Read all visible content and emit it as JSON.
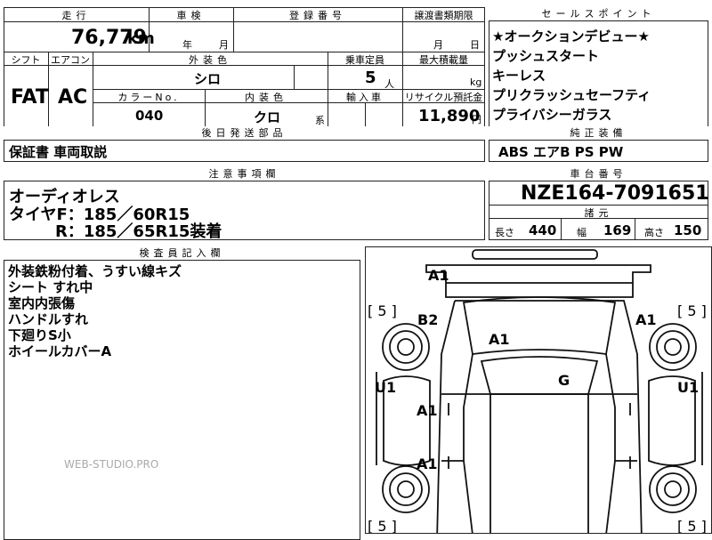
{
  "header": {
    "mileage_label": "走行",
    "shaken_label": "車検",
    "reg_label": "登録番号",
    "transfer_label": "譲渡書類期限",
    "sales_label": "セールスポイント"
  },
  "values": {
    "mileage": "76,779",
    "km_unit": "km",
    "shaken_year": "年",
    "shaken_month": "月",
    "transfer_month": "月",
    "transfer_day": "日"
  },
  "spec": {
    "shift_label": "シフト",
    "ac_label": "エアコン",
    "exterior_label": "外装色",
    "capacity_label": "乗車定員",
    "load_label": "最大積載量",
    "shift": "FAT",
    "ac": "AC",
    "exterior": "シロ",
    "capacity": "5",
    "capacity_unit": "人",
    "load_unit": "kg",
    "color_no_label": "カラーNo.",
    "interior_label": "内装色",
    "import_label": "輸入車",
    "recycle_label": "リサイクル預託金",
    "color_no": "040",
    "interior": "クロ",
    "interior_unit": "系",
    "recycle": "11,890",
    "recycle_unit": "円"
  },
  "sales_points": [
    "★オークションデビュー★",
    "プッシュスタート",
    "キーレス",
    "プリクラッシュセーフティ",
    "プライバシーガラス"
  ],
  "later_parts": {
    "label": "後日発送部品",
    "value": "保証書 車両取説"
  },
  "genuine": {
    "label": "純正装備",
    "value": "ABS エアB PS PW"
  },
  "notes": {
    "label": "注意事項欄",
    "lines": [
      "オーディオレス",
      "タイヤF：185／60R15",
      "R：185／65R15装着"
    ]
  },
  "chassis": {
    "label": "車台番号",
    "value": "NZE164-7091651",
    "dims_label": "諸元",
    "len_label": "長さ",
    "len": "440",
    "wid_label": "幅",
    "wid": "169",
    "hgt_label": "高さ",
    "hgt": "150"
  },
  "inspector": {
    "label": "検査員記入欄",
    "lines": [
      "外装鉄粉付着、うすい線キズ",
      "シート すれ中",
      "室内内張傷",
      "ハンドルすれ",
      "下廻りS小",
      "ホイールカバーA"
    ]
  },
  "diagram": {
    "labels": [
      "A1",
      "B2",
      "A1",
      "A1",
      "G",
      "U1",
      "U1",
      "A1",
      "A1",
      "[ 5 ]",
      "[ 5 ]",
      "[ 5 ]",
      "[ 5 ]"
    ]
  },
  "watermark": "WEB-STUDIO.PRO"
}
